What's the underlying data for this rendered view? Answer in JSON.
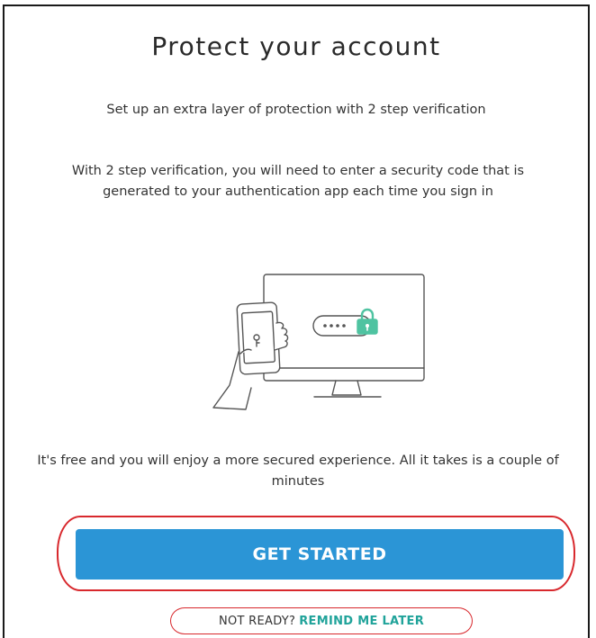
{
  "dialog": {
    "title": "Protect your account",
    "subtitle": "Set up an extra layer of protection with 2 step verification",
    "description": "With 2 step verification, you will need to enter a security code that is generated to your authentication app each time you sign in",
    "footer_text": "It's free and you will enjoy a more secured experience. All it takes is a couple of minutes",
    "primary_button": "GET STARTED",
    "remind_prefix": "NOT READY?",
    "remind_link": "REMIND ME LATER"
  },
  "colors": {
    "primary": "#2b95d6",
    "link": "#20a39a",
    "lock": "#4fc3a1",
    "highlight": "#d8282d"
  },
  "icons": {
    "illustration": "phone-and-monitor-with-lock-illustration"
  }
}
